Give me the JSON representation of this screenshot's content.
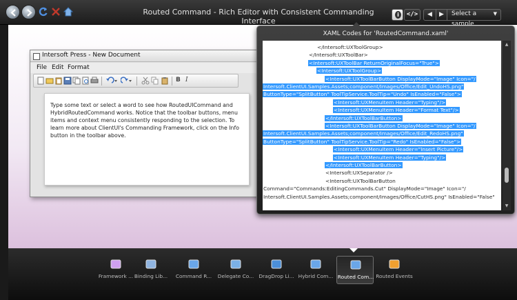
{
  "app": {
    "title": "Routed Command - Rich Editor with Consistent Commanding Interface",
    "code_button_label": "</>",
    "select_sample_label": "Select a sample"
  },
  "editor": {
    "window_title": "Intersoft Press - New Document",
    "menu": [
      "File",
      "Edit",
      "Format"
    ],
    "toolbar_icons": [
      "new-doc-icon",
      "open-icon",
      "save-icon",
      "paste-icon",
      "copy-doc-icon",
      "print-icon",
      "undo-icon",
      "redo-icon",
      "cut-icon",
      "copy-icon",
      "paste2-icon",
      "bold-icon",
      "italic-icon"
    ],
    "bold_label": "B",
    "italic_label": "I",
    "document_text": "Type some text or select a word to see how RoutedUICommand and HybridRoutedCommand works. Notice that the toolbar buttons, menu items and context menu consistently responding to the selection. To learn more about ClientUI's Commanding Framework, click on the Info button in the toolbar above."
  },
  "code_panel": {
    "title": "XAML Codes for 'RoutedCommand.xaml'",
    "lines": [
      {
        "text": "</Intersoft:UXToolGroup>",
        "indent": 78,
        "selected": false
      },
      {
        "text": "</Intersoft:UXToolBar>",
        "indent": 66,
        "selected": false
      },
      {
        "text": "<Intersoft:UXToolBar ReturnOriginalFocus=\"True\">",
        "indent": 66,
        "selected": true
      },
      {
        "text": "<Intersoft:UXToolGroup>",
        "indent": 78,
        "selected": true
      },
      {
        "text": "<Intersoft:UXToolBarButton DisplayMode=\"Image\" Icon=\"/",
        "indent": 90,
        "selected": true
      },
      {
        "text": "Intersoft.ClientUI.Samples.Assets;component/Images/Office/Edit_UndoHS.png\"",
        "indent": 0,
        "selected": true
      },
      {
        "text": "ButtonType=\"SplitButton\" ToolTipService.ToolTip=\"Undo\" IsEnabled=\"False\">",
        "indent": 0,
        "selected": true
      },
      {
        "text": "<Intersoft:UXMenuItem Header=\"Typing\"/>",
        "indent": 102,
        "selected": true
      },
      {
        "text": "<Intersoft:UXMenuItem Header=\"Format Text\"/>",
        "indent": 102,
        "selected": true
      },
      {
        "text": "</Intersoft:UXToolBarButton>",
        "indent": 90,
        "selected": true
      },
      {
        "text": "<Intersoft:UXToolBarButton DisplayMode=\"Image\" Icon=\"/",
        "indent": 90,
        "selected": true
      },
      {
        "text": "Intersoft.ClientUI.Samples.Assets;component/Images/Office/Edit_RedoHS.png\"",
        "indent": 0,
        "selected": true
      },
      {
        "text": "ButtonType=\"SplitButton\" ToolTipService.ToolTip=\"Redo\" IsEnabled=\"False\">",
        "indent": 0,
        "selected": true
      },
      {
        "text": "<Intersoft:UXMenuItem Header=\"Insert Picture\"/>",
        "indent": 102,
        "selected": true
      },
      {
        "text": "<Intersoft:UXMenuItem Header=\"Typing\"/>",
        "indent": 102,
        "selected": true
      },
      {
        "text": "</Intersoft:UXToolBarButton>",
        "indent": 90,
        "selected": true
      },
      {
        "text": "<Intersoft:UXSeparator />",
        "indent": 90,
        "selected": false
      },
      {
        "text": "<Intersoft:UXToolBarButton",
        "indent": 90,
        "selected": false
      },
      {
        "text": "Command=\"Commands:EditingCommands.Cut\" DisplayMode=\"Image\" Icon=\"/",
        "indent": 0,
        "selected": false
      },
      {
        "text": "Intersoft.ClientUI.Samples.Assets;component/Images/Office/CutHS.png\" IsEnabled=\"False\"",
        "indent": 0,
        "selected": false
      }
    ]
  },
  "dock": {
    "items": [
      {
        "label": "Framework ...",
        "icon": "framework-icon",
        "active": false
      },
      {
        "label": "Binding Lib...",
        "icon": "binding-icon",
        "active": false
      },
      {
        "label": "Command R...",
        "icon": "command-icon",
        "active": false
      },
      {
        "label": "Delegate Co...",
        "icon": "delegate-icon",
        "active": false
      },
      {
        "label": "DragDrop Li...",
        "icon": "dragdrop-icon",
        "active": false
      },
      {
        "label": "Hybrid Com...",
        "icon": "hybrid-icon",
        "active": false
      },
      {
        "label": "Routed Com...",
        "icon": "routed-icon",
        "active": true
      },
      {
        "label": "Routed Events",
        "icon": "events-icon",
        "active": false
      }
    ]
  }
}
